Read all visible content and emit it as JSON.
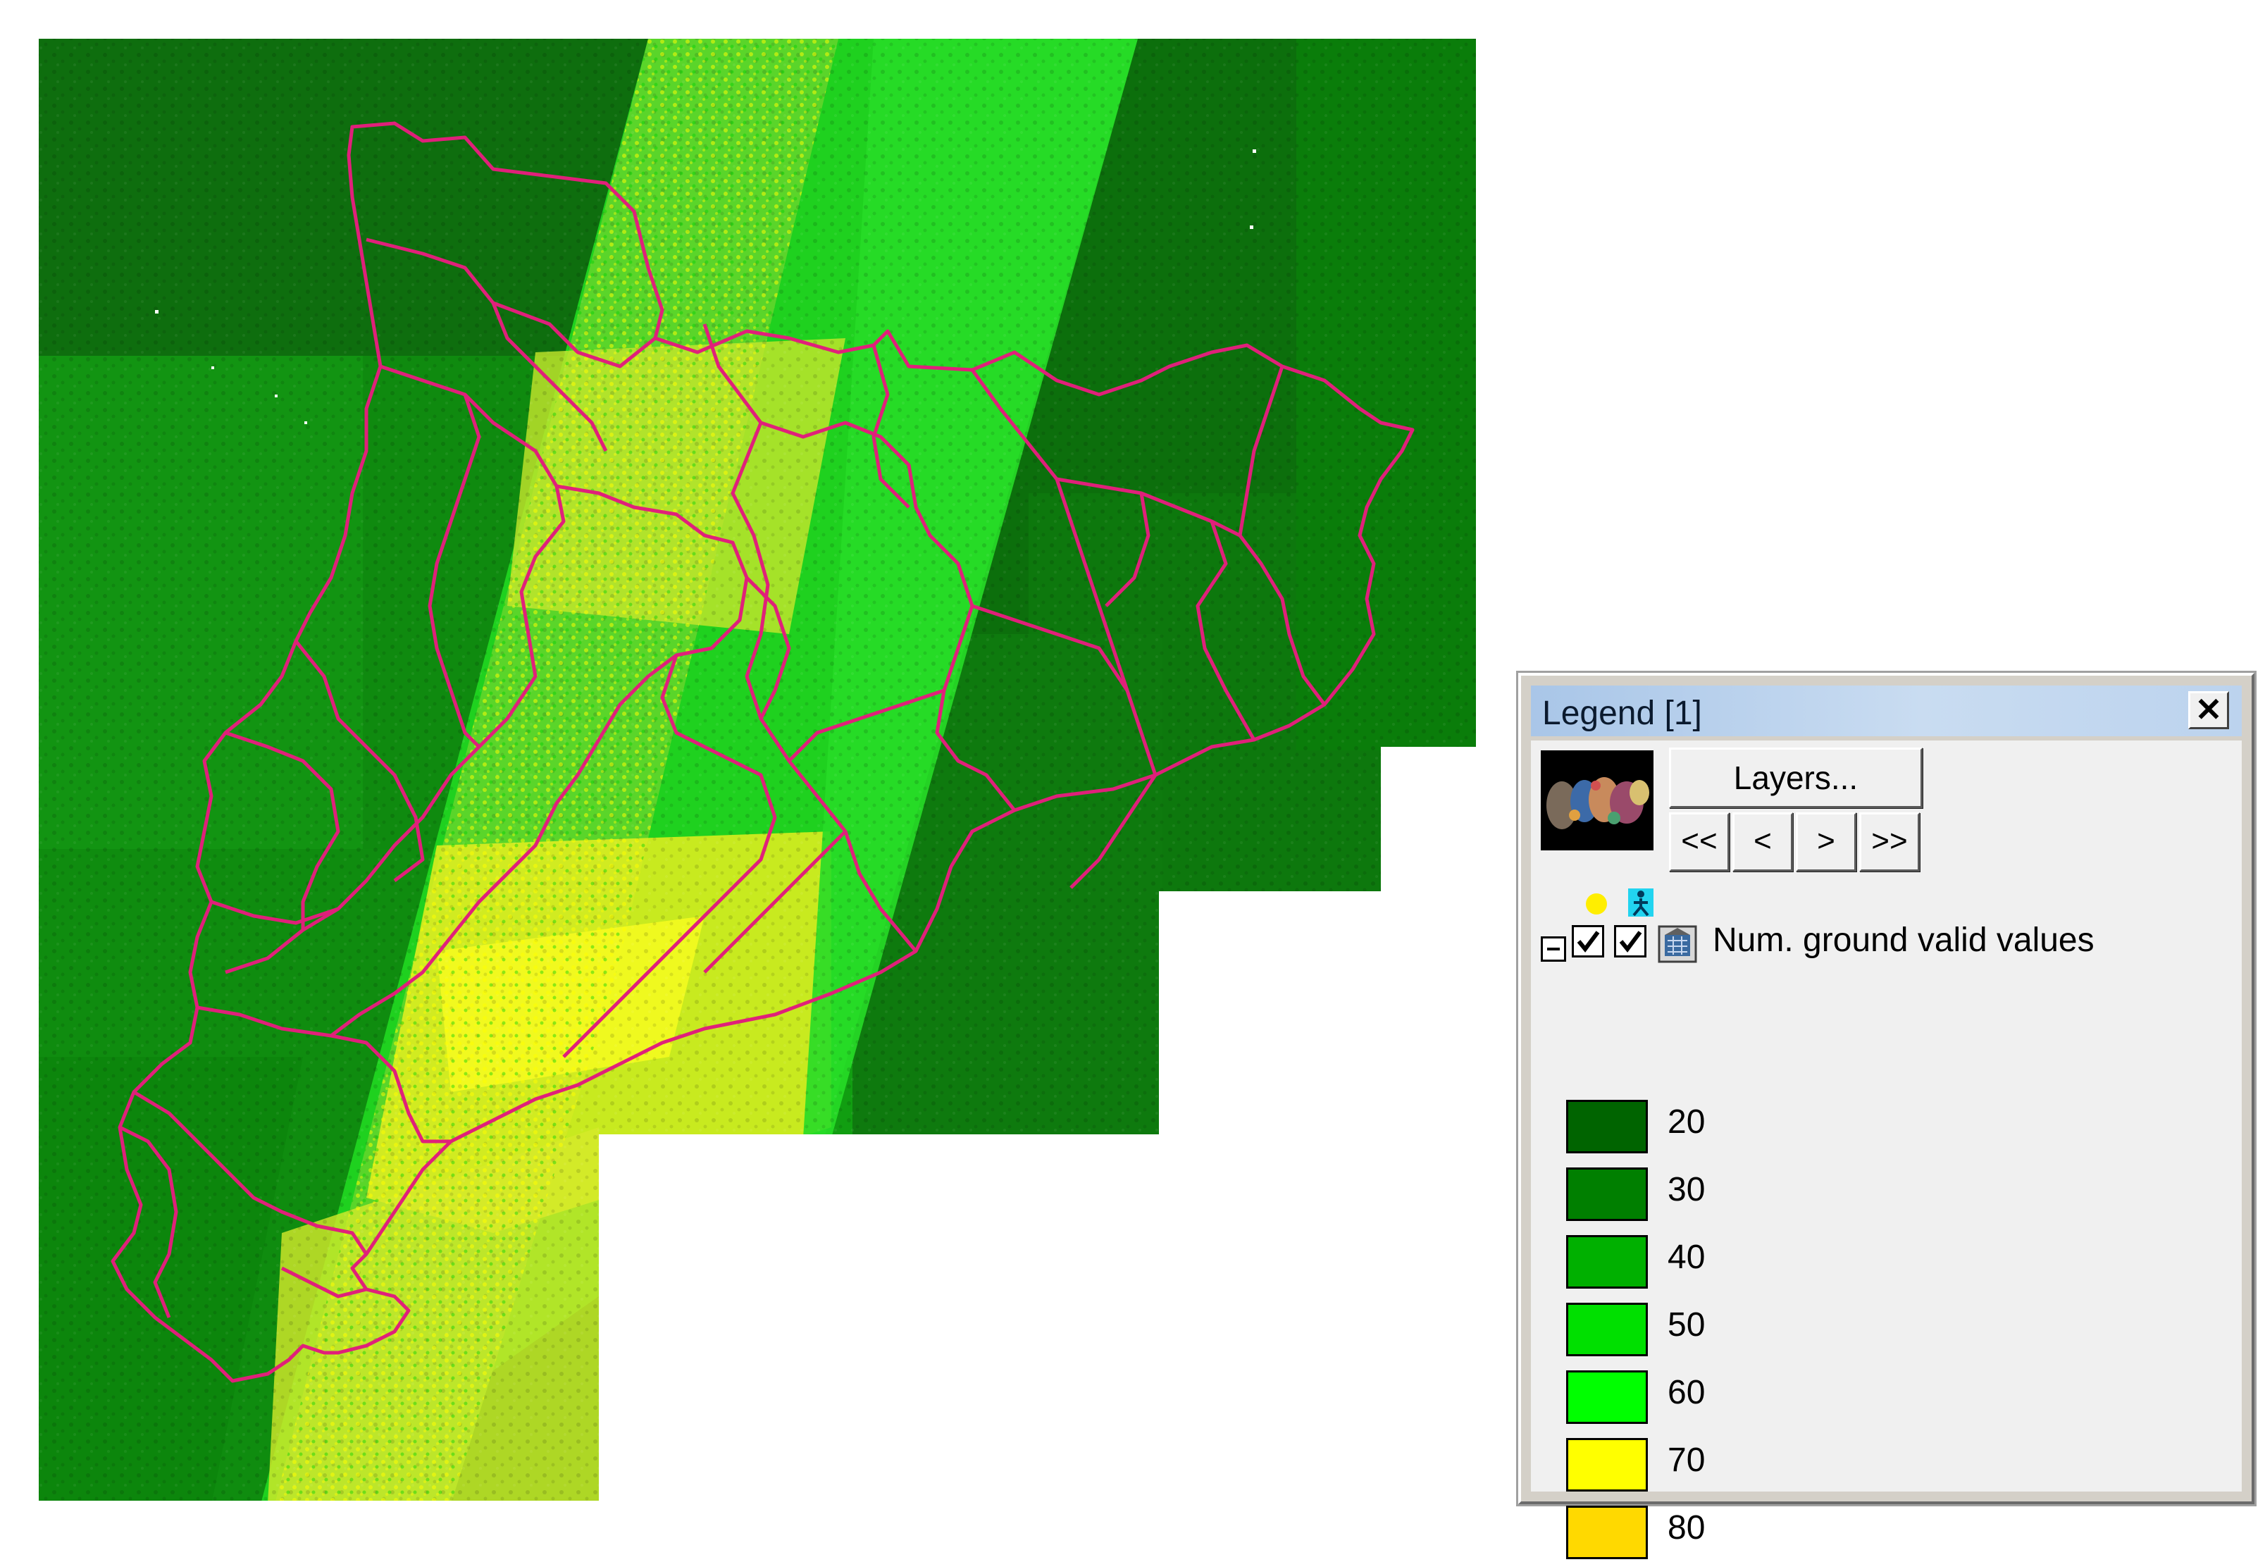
{
  "legend": {
    "title": "Legend [1]",
    "close_icon": "close-icon",
    "layers_button": "Layers...",
    "nav": {
      "first": "<<",
      "prev": "<",
      "next": ">",
      "last": ">>"
    },
    "layer": {
      "name": "Num. ground valid values",
      "visible": true,
      "queryable": true,
      "thumbnail_icon": "map-thumbnail-icon",
      "layer_icon": "raster-layer-icon"
    },
    "entries": [
      {
        "label": "20",
        "color": "#006400"
      },
      {
        "label": "30",
        "color": "#007f00"
      },
      {
        "label": "40",
        "color": "#00b000"
      },
      {
        "label": "50",
        "color": "#00e000"
      },
      {
        "label": "60",
        "color": "#00ff00"
      },
      {
        "label": "70",
        "color": "#ffff00"
      },
      {
        "label": "80",
        "color": "#ffd900"
      }
    ]
  },
  "map": {
    "boundary_color": "#e0207a",
    "background_color": "#ffffff"
  }
}
